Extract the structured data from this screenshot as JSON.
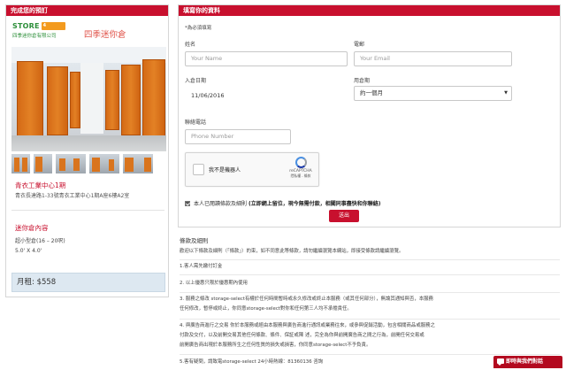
{
  "left": {
    "header": "完成您的預訂",
    "logo": {
      "store": "STORE",
      "badge": "4 seasons",
      "sub": "四季迷你倉有限公司"
    },
    "brand_name": "四季迷你倉",
    "location_title": "青衣工業中心1期",
    "location_address": "青衣長達路1-33號青衣工業中心1期A座6樓A2室",
    "unit_title": "迷你倉內容",
    "unit_size": "超小型倉(16 – 20呎)",
    "unit_dim": "5.0' X 4.0'",
    "price": "月租: $558"
  },
  "form": {
    "header": "填寫你的資料",
    "required_note": "*為必須填寫",
    "name_label": "姓名",
    "name_placeholder": "Your Name",
    "email_label": "電郵",
    "email_placeholder": "Your Email",
    "date_label": "入倉日期",
    "date_value": "11/06/2016",
    "period_label": "用倉期",
    "period_value": "約一個月",
    "phone_label": "聯絡電話",
    "phone_placeholder": "Phone Number",
    "captcha_label": "我不是機器人",
    "captcha_name": "reCAPTCHA",
    "captcha_links": "隱私權 - 條款",
    "agree_text": "本人已閱讀條款及細則",
    "agree_bold": "(立即網上留位，現今無需付款，相關同事盡快和你聯絡)",
    "submit_label": "送出"
  },
  "terms": {
    "title": "條款及細則",
    "intro": "歡迎以下條款及細則（「條款」）的束，如不同意此等條款，請勿繼續瀏覽本網站，即接受條款請繼續瀏覽。",
    "item1": "1.客人需先繳付訂金",
    "item2": "2. 以上優惠只限於優惠期內使用",
    "item3a": "3. 服務之條改 storage-select有權於任何時間暫時或永久修改或終止本服務（或其任何部分），無論其通知與否，本服務",
    "item3b": "任何修改，暫停或終止，你同意storage-select對你和任何第三人均不承擔責任。",
    "item4a": "4. 與廣告商進行之交易 你於本服務或經由本服務與廣告商進行通訊或業務往來，或參與促銷活動，包含相關商品或服務之",
    "item4b": "付款及交付，以及前開交易其他任何條款、條件、保証或陳 述，完全為你與前開廣告商之間之行為，前開任何交易或",
    "item4c": "前開廣告商出現於本服務所生之任何性質的損失或損害，你同意storage-select不予負責。",
    "item5": "5.客有疑問，請致電storage-select 24小時熱線：81360136 咨詢"
  },
  "chat_label": "即時與我們對話",
  "colors": {
    "accent": "#c8102e",
    "price_bg": "#dde8f1",
    "brand_green": "#2d8f3a"
  }
}
